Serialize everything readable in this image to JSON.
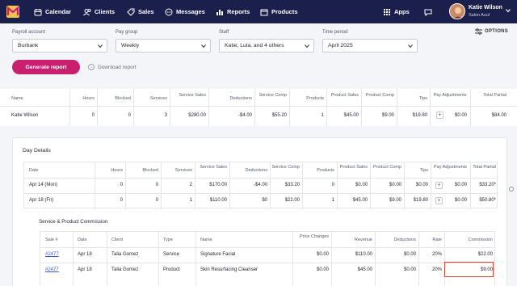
{
  "nav": {
    "items": [
      {
        "label": "Calendar",
        "icon": "calendar-icon"
      },
      {
        "label": "Clients",
        "icon": "clients-icon"
      },
      {
        "label": "Sales",
        "icon": "sales-tag-icon"
      },
      {
        "label": "Messages",
        "icon": "messages-icon"
      },
      {
        "label": "Reports",
        "icon": "reports-chart-icon"
      },
      {
        "label": "Products",
        "icon": "products-box-icon"
      }
    ],
    "apps": "Apps",
    "user_name": "Katie Wilson",
    "user_sub": "Salon Azul"
  },
  "filters": {
    "payroll_label": "Payroll account",
    "payroll_value": "Burbank",
    "paygroup_label": "Pay group",
    "paygroup_value": "Weekly",
    "staff_label": "Staff",
    "staff_value": "Katie, Lula, and 4 others",
    "period_label": "Time period",
    "period_value": "April 2025",
    "options": "OPTIONS"
  },
  "actions": {
    "generate": "Generate report",
    "download": "Download report"
  },
  "summary": {
    "headers": [
      "Name",
      "Hours",
      "Blocked",
      "Services",
      "Service Sales",
      "Deductions",
      "Service Comp",
      "Products",
      "Product Sales",
      "Product Comp",
      "Tips",
      "Pay Adjustments",
      "Total Partial"
    ],
    "row": [
      "Katie Wilson",
      "0",
      "0",
      "3",
      "$280.00",
      "-$4.00",
      "$55.20",
      "1",
      "$45.00",
      "$9.00",
      "$19.80",
      "$0.00",
      "$84.00"
    ]
  },
  "day": {
    "title": "Day Details",
    "headers": [
      "Date",
      "Hours",
      "Blocked",
      "Services",
      "Service Sales",
      "Deductions",
      "Service Comp",
      "Products",
      "Product Sales",
      "Product Comp",
      "Tips",
      "Pay Adjustments",
      "Total Partial"
    ],
    "rows": [
      [
        "Apr 14 (Mon)",
        "0",
        "0",
        "2",
        "$170.00",
        "-$4.00",
        "$33.20",
        "0",
        "$0.00",
        "$0.00",
        "$0.00",
        "$0.00",
        "$33.20*"
      ],
      [
        "Apr 18 (Fri)",
        "0",
        "0",
        "1",
        "$110.00",
        "$0",
        "$22.00",
        "1",
        "$45.00",
        "$9.00",
        "$19.80",
        "$0.00",
        "$50.80*"
      ]
    ]
  },
  "commission": {
    "title": "Service & Product Commission",
    "headers": [
      "Sale #",
      "Date",
      "Client",
      "Type",
      "Name",
      "Price Changes",
      "Revenue",
      "Deductions",
      "Rate",
      "Commission"
    ],
    "rows": [
      [
        "#2477",
        "Apr 18",
        "Talia Gomez",
        "Service",
        "Signature Facial",
        "$0.00",
        "$110.00",
        "$0.00",
        "20%",
        "$22.00"
      ],
      [
        "#2477",
        "Apr 18",
        "Talia Gomez",
        "Product",
        "Skin Resurfacing Cleanser",
        "$0.00",
        "$45.00",
        "$0.00",
        "20%",
        "$9.00"
      ]
    ]
  },
  "colors": {
    "nav_bg": "#1b1f4b",
    "accent": "#c8206e",
    "highlight": "#e0432b"
  }
}
